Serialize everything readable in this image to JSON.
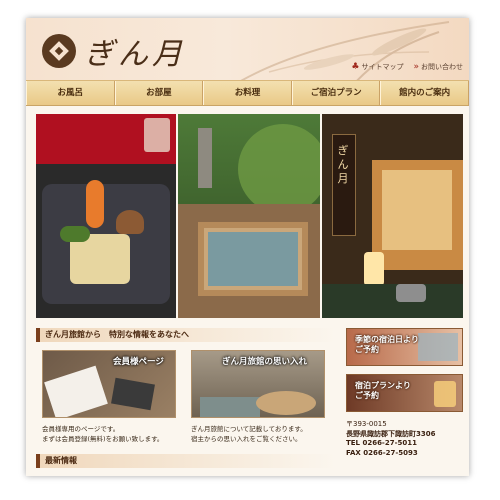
{
  "header": {
    "logo_text": "ぎん月",
    "util_links": [
      {
        "icon": "sitemap-icon",
        "label": "サイトマップ"
      },
      {
        "icon": "arrow-icon",
        "label": "お問い合わせ"
      }
    ]
  },
  "nav": {
    "items": [
      "お風呂",
      "お部屋",
      "お料理",
      "ご宿泊プラン",
      "館内のご案内"
    ]
  },
  "hero": {
    "sign_text": "ぎん月"
  },
  "main": {
    "section_title": "ぎん月旅館から　特別な情報をあなたへ",
    "cards": [
      {
        "badge": "会員様ページ",
        "text_line1": "会員様専用のページです。",
        "text_line2": "まずは会員登録(無料)をお願い致します。"
      },
      {
        "badge": "ぎん月旅館の思い入れ",
        "text_line1": "ぎん月旅館について記載しております。",
        "text_line2": "宿主からの思い入れをご覧ください。"
      }
    ],
    "news_title": "最新情報"
  },
  "side": {
    "banner1": {
      "line1": "季節の宿泊日より",
      "line2": "ご予約"
    },
    "banner2": {
      "line1": "宿泊プランより",
      "line2": "ご予約"
    },
    "address": {
      "postal": "〒393-0015",
      "location": "長野県諏訪郡下諏訪町3306",
      "tel": "TEL 0266-27-5011",
      "fax": "FAX 0266-27-5093"
    }
  },
  "colors": {
    "accent": "#7a3f1c",
    "nav_bg": "#e9c987",
    "header_bg": "#f6e2cf"
  }
}
